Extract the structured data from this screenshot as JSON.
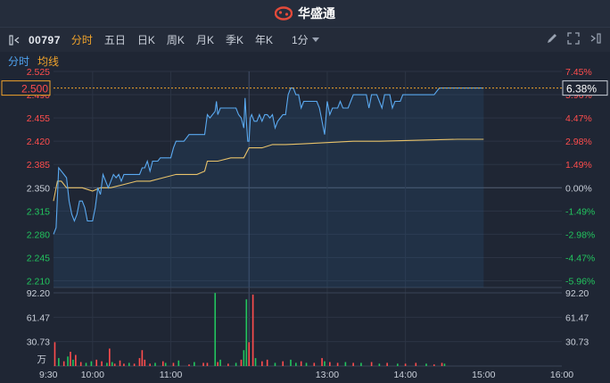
{
  "app": {
    "name": "华盛通"
  },
  "toolbar": {
    "code": "00797",
    "items": [
      "分时",
      "五日",
      "日K",
      "周K",
      "月K",
      "季K",
      "年K"
    ],
    "active_index": 0,
    "interval": "1分"
  },
  "subtabs": [
    "分时",
    "均线"
  ],
  "chart_data": {
    "type": "line",
    "title": "",
    "x_ticks": [
      "9:30",
      "10:00",
      "11:00",
      "13:00",
      "14:00",
      "15:00",
      "16:00"
    ],
    "price_ticks_left": [
      "2.525",
      "2.490",
      "2.455",
      "2.420",
      "2.385",
      "2.350",
      "2.315",
      "2.280",
      "2.245",
      "2.210"
    ],
    "price_ticks_right": [
      "7.45%",
      "5.96%",
      "4.47%",
      "2.98%",
      "1.49%",
      "0.00%",
      "-1.49%",
      "-2.98%",
      "-4.47%",
      "-5.96%"
    ],
    "price_ylim": [
      2.2,
      2.525
    ],
    "prev_close": 2.35,
    "current_price_label": "2.500",
    "current_pct_label": "6.38%",
    "volume_ticks": [
      "92.20",
      "61.47",
      "30.73"
    ],
    "volume_unit": "万",
    "volume_max": 92.2,
    "series": [
      {
        "name": "price",
        "color": "#5aa9f0",
        "points": [
          [
            0,
            2.28
          ],
          [
            2,
            2.29
          ],
          [
            4,
            2.38
          ],
          [
            6,
            2.375
          ],
          [
            8,
            2.37
          ],
          [
            10,
            2.365
          ],
          [
            12,
            2.33
          ],
          [
            14,
            2.31
          ],
          [
            16,
            2.3
          ],
          [
            18,
            2.31
          ],
          [
            20,
            2.33
          ],
          [
            22,
            2.33
          ],
          [
            24,
            2.32
          ],
          [
            26,
            2.3
          ],
          [
            28,
            2.3
          ],
          [
            30,
            2.3
          ],
          [
            32,
            2.32
          ],
          [
            34,
            2.35
          ],
          [
            36,
            2.34
          ],
          [
            38,
            2.37
          ],
          [
            40,
            2.36
          ],
          [
            42,
            2.35
          ],
          [
            44,
            2.36
          ],
          [
            46,
            2.37
          ],
          [
            48,
            2.365
          ],
          [
            50,
            2.37
          ],
          [
            52,
            2.36
          ],
          [
            54,
            2.37
          ],
          [
            56,
            2.37
          ],
          [
            58,
            2.37
          ],
          [
            60,
            2.37
          ],
          [
            62,
            2.37
          ],
          [
            64,
            2.37
          ],
          [
            66,
            2.37
          ],
          [
            68,
            2.38
          ],
          [
            70,
            2.38
          ],
          [
            72,
            2.39
          ],
          [
            74,
            2.375
          ],
          [
            76,
            2.39
          ],
          [
            78,
            2.39
          ],
          [
            80,
            2.39
          ],
          [
            82,
            2.395
          ],
          [
            84,
            2.395
          ],
          [
            86,
            2.395
          ],
          [
            88,
            2.395
          ],
          [
            90,
            2.395
          ],
          [
            92,
            2.41
          ],
          [
            94,
            2.42
          ],
          [
            96,
            2.42
          ],
          [
            98,
            2.42
          ],
          [
            100,
            2.42
          ],
          [
            102,
            2.425
          ],
          [
            104,
            2.43
          ],
          [
            106,
            2.43
          ],
          [
            108,
            2.43
          ],
          [
            110,
            2.43
          ],
          [
            112,
            2.43
          ],
          [
            114,
            2.43
          ],
          [
            116,
            2.43
          ],
          [
            118,
            2.46
          ],
          [
            120,
            2.455
          ],
          [
            122,
            2.46
          ],
          [
            124,
            2.465
          ],
          [
            125,
            2.48
          ],
          [
            126,
            2.46
          ],
          [
            128,
            2.47
          ],
          [
            130,
            2.47
          ],
          [
            132,
            2.47
          ],
          [
            134,
            2.47
          ],
          [
            136,
            2.47
          ],
          [
            138,
            2.47
          ],
          [
            140,
            2.47
          ],
          [
            142,
            2.46
          ],
          [
            144,
            2.455
          ],
          [
            146,
            2.44
          ],
          [
            147,
            2.485
          ],
          [
            148,
            2.45
          ],
          [
            149,
            2.42
          ],
          [
            150,
            2.42
          ],
          [
            151,
            2.455
          ],
          [
            152,
            2.46
          ],
          [
            154,
            2.45
          ],
          [
            156,
            2.45
          ],
          [
            158,
            2.46
          ],
          [
            160,
            2.45
          ],
          [
            162,
            2.46
          ],
          [
            164,
            2.46
          ],
          [
            166,
            2.455
          ],
          [
            168,
            2.46
          ],
          [
            170,
            2.44
          ],
          [
            172,
            2.45
          ],
          [
            174,
            2.455
          ],
          [
            176,
            2.46
          ],
          [
            178,
            2.46
          ],
          [
            180,
            2.49
          ],
          [
            182,
            2.5
          ],
          [
            184,
            2.5
          ],
          [
            186,
            2.49
          ],
          [
            188,
            2.49
          ],
          [
            190,
            2.47
          ],
          [
            192,
            2.48
          ],
          [
            194,
            2.48
          ],
          [
            196,
            2.48
          ],
          [
            198,
            2.48
          ],
          [
            200,
            2.48
          ],
          [
            202,
            2.48
          ],
          [
            204,
            2.47
          ],
          [
            206,
            2.45
          ],
          [
            208,
            2.43
          ],
          [
            210,
            2.48
          ],
          [
            212,
            2.46
          ],
          [
            214,
            2.47
          ],
          [
            216,
            2.47
          ],
          [
            218,
            2.47
          ],
          [
            220,
            2.48
          ],
          [
            222,
            2.47
          ],
          [
            224,
            2.47
          ],
          [
            226,
            2.47
          ],
          [
            228,
            2.48
          ],
          [
            230,
            2.49
          ],
          [
            232,
            2.49
          ],
          [
            234,
            2.49
          ],
          [
            236,
            2.49
          ],
          [
            238,
            2.49
          ],
          [
            240,
            2.49
          ],
          [
            242,
            2.47
          ],
          [
            244,
            2.49
          ],
          [
            246,
            2.49
          ],
          [
            248,
            2.49
          ],
          [
            250,
            2.48
          ],
          [
            252,
            2.47
          ],
          [
            254,
            2.49
          ],
          [
            256,
            2.49
          ],
          [
            258,
            2.49
          ],
          [
            260,
            2.47
          ],
          [
            262,
            2.48
          ],
          [
            264,
            2.48
          ],
          [
            266,
            2.48
          ],
          [
            268,
            2.49
          ],
          [
            270,
            2.49
          ],
          [
            272,
            2.49
          ],
          [
            274,
            2.49
          ],
          [
            276,
            2.49
          ],
          [
            278,
            2.49
          ],
          [
            280,
            2.49
          ],
          [
            282,
            2.49
          ],
          [
            284,
            2.49
          ],
          [
            286,
            2.49
          ],
          [
            288,
            2.49
          ],
          [
            290,
            2.49
          ],
          [
            292,
            2.49
          ],
          [
            294,
            2.495
          ],
          [
            296,
            2.5
          ],
          [
            298,
            2.5
          ],
          [
            300,
            2.5
          ],
          [
            305,
            2.5
          ],
          [
            310,
            2.5
          ],
          [
            315,
            2.5
          ],
          [
            320,
            2.5
          ],
          [
            325,
            2.5
          ],
          [
            330,
            2.5
          ]
        ]
      },
      {
        "name": "average",
        "color": "#e8c26a",
        "points": [
          [
            0,
            2.33
          ],
          [
            3,
            2.36
          ],
          [
            6,
            2.36
          ],
          [
            10,
            2.35
          ],
          [
            16,
            2.35
          ],
          [
            22,
            2.35
          ],
          [
            30,
            2.345
          ],
          [
            36,
            2.35
          ],
          [
            44,
            2.35
          ],
          [
            54,
            2.355
          ],
          [
            64,
            2.36
          ],
          [
            74,
            2.36
          ],
          [
            84,
            2.365
          ],
          [
            94,
            2.37
          ],
          [
            104,
            2.37
          ],
          [
            110,
            2.37
          ],
          [
            116,
            2.375
          ],
          [
            118,
            2.39
          ],
          [
            126,
            2.39
          ],
          [
            136,
            2.395
          ],
          [
            146,
            2.395
          ],
          [
            150,
            2.41
          ],
          [
            160,
            2.41
          ],
          [
            168,
            2.415
          ],
          [
            178,
            2.415
          ],
          [
            190,
            2.416
          ],
          [
            210,
            2.418
          ],
          [
            230,
            2.42
          ],
          [
            250,
            2.42
          ],
          [
            270,
            2.421
          ],
          [
            290,
            2.422
          ],
          [
            310,
            2.423
          ],
          [
            330,
            2.423
          ]
        ]
      }
    ],
    "volume_bars": [
      {
        "t": 1,
        "v": 30,
        "c": "r"
      },
      {
        "t": 4,
        "v": 10,
        "c": "g"
      },
      {
        "t": 8,
        "v": 6,
        "c": "r"
      },
      {
        "t": 11,
        "v": 12,
        "c": "g"
      },
      {
        "t": 13,
        "v": 18,
        "c": "r"
      },
      {
        "t": 15,
        "v": 8,
        "c": "g"
      },
      {
        "t": 17,
        "v": 14,
        "c": "r"
      },
      {
        "t": 21,
        "v": 5,
        "c": "r"
      },
      {
        "t": 25,
        "v": 4,
        "c": "g"
      },
      {
        "t": 29,
        "v": 6,
        "c": "g"
      },
      {
        "t": 33,
        "v": 8,
        "c": "r"
      },
      {
        "t": 37,
        "v": 6,
        "c": "r"
      },
      {
        "t": 41,
        "v": 4,
        "c": "g"
      },
      {
        "t": 43,
        "v": 22,
        "c": "r"
      },
      {
        "t": 45,
        "v": 5,
        "c": "g"
      },
      {
        "t": 47,
        "v": 3,
        "c": "r"
      },
      {
        "t": 51,
        "v": 7,
        "c": "r"
      },
      {
        "t": 54,
        "v": 3,
        "c": "r"
      },
      {
        "t": 58,
        "v": 4,
        "c": "g"
      },
      {
        "t": 62,
        "v": 3,
        "c": "r"
      },
      {
        "t": 66,
        "v": 10,
        "c": "r"
      },
      {
        "t": 68,
        "v": 20,
        "c": "r"
      },
      {
        "t": 70,
        "v": 8,
        "c": "r"
      },
      {
        "t": 74,
        "v": 3,
        "c": "r"
      },
      {
        "t": 78,
        "v": 4,
        "c": "g"
      },
      {
        "t": 84,
        "v": 6,
        "c": "r"
      },
      {
        "t": 86,
        "v": 4,
        "c": "g"
      },
      {
        "t": 92,
        "v": 4,
        "c": "r"
      },
      {
        "t": 96,
        "v": 7,
        "c": "g"
      },
      {
        "t": 104,
        "v": 2,
        "c": "r"
      },
      {
        "t": 108,
        "v": 5,
        "c": "g"
      },
      {
        "t": 115,
        "v": 4,
        "c": "r"
      },
      {
        "t": 118,
        "v": 4,
        "c": "r"
      },
      {
        "t": 124,
        "v": 92,
        "c": "g"
      },
      {
        "t": 126,
        "v": 5,
        "c": "r"
      },
      {
        "t": 128,
        "v": 8,
        "c": "g"
      },
      {
        "t": 134,
        "v": 3,
        "c": "r"
      },
      {
        "t": 140,
        "v": 4,
        "c": "g"
      },
      {
        "t": 144,
        "v": 8,
        "c": "r"
      },
      {
        "t": 146,
        "v": 20,
        "c": "g"
      },
      {
        "t": 148,
        "v": 84,
        "c": "g"
      },
      {
        "t": 150,
        "v": 30,
        "c": "r"
      },
      {
        "t": 153,
        "v": 90,
        "c": "r"
      },
      {
        "t": 155,
        "v": 10,
        "c": "g"
      },
      {
        "t": 160,
        "v": 6,
        "c": "r"
      },
      {
        "t": 164,
        "v": 8,
        "c": "r"
      },
      {
        "t": 170,
        "v": 4,
        "c": "g"
      },
      {
        "t": 176,
        "v": 6,
        "c": "r"
      },
      {
        "t": 182,
        "v": 8,
        "c": "g"
      },
      {
        "t": 186,
        "v": 4,
        "c": "g"
      },
      {
        "t": 190,
        "v": 6,
        "c": "r"
      },
      {
        "t": 194,
        "v": 4,
        "c": "g"
      },
      {
        "t": 200,
        "v": 4,
        "c": "r"
      },
      {
        "t": 206,
        "v": 10,
        "c": "r"
      },
      {
        "t": 208,
        "v": 6,
        "c": "g"
      },
      {
        "t": 212,
        "v": 5,
        "c": "r"
      },
      {
        "t": 218,
        "v": 4,
        "c": "r"
      },
      {
        "t": 224,
        "v": 5,
        "c": "g"
      },
      {
        "t": 230,
        "v": 4,
        "c": "r"
      },
      {
        "t": 236,
        "v": 4,
        "c": "g"
      },
      {
        "t": 244,
        "v": 5,
        "c": "r"
      },
      {
        "t": 250,
        "v": 3,
        "c": "g"
      },
      {
        "t": 256,
        "v": 4,
        "c": "r"
      },
      {
        "t": 264,
        "v": 3,
        "c": "g"
      },
      {
        "t": 270,
        "v": 3,
        "c": "r"
      },
      {
        "t": 278,
        "v": 4,
        "c": "r"
      },
      {
        "t": 286,
        "v": 3,
        "c": "g"
      },
      {
        "t": 292,
        "v": 2,
        "c": "r"
      },
      {
        "t": 298,
        "v": 4,
        "c": "r"
      },
      {
        "t": 300,
        "v": 3,
        "c": "g"
      }
    ]
  },
  "colors": {
    "up": "#ff4d4d",
    "down": "#22c55e",
    "accent": "#f0a32b",
    "price": "#5aa9f0",
    "avg": "#e8c26a"
  }
}
